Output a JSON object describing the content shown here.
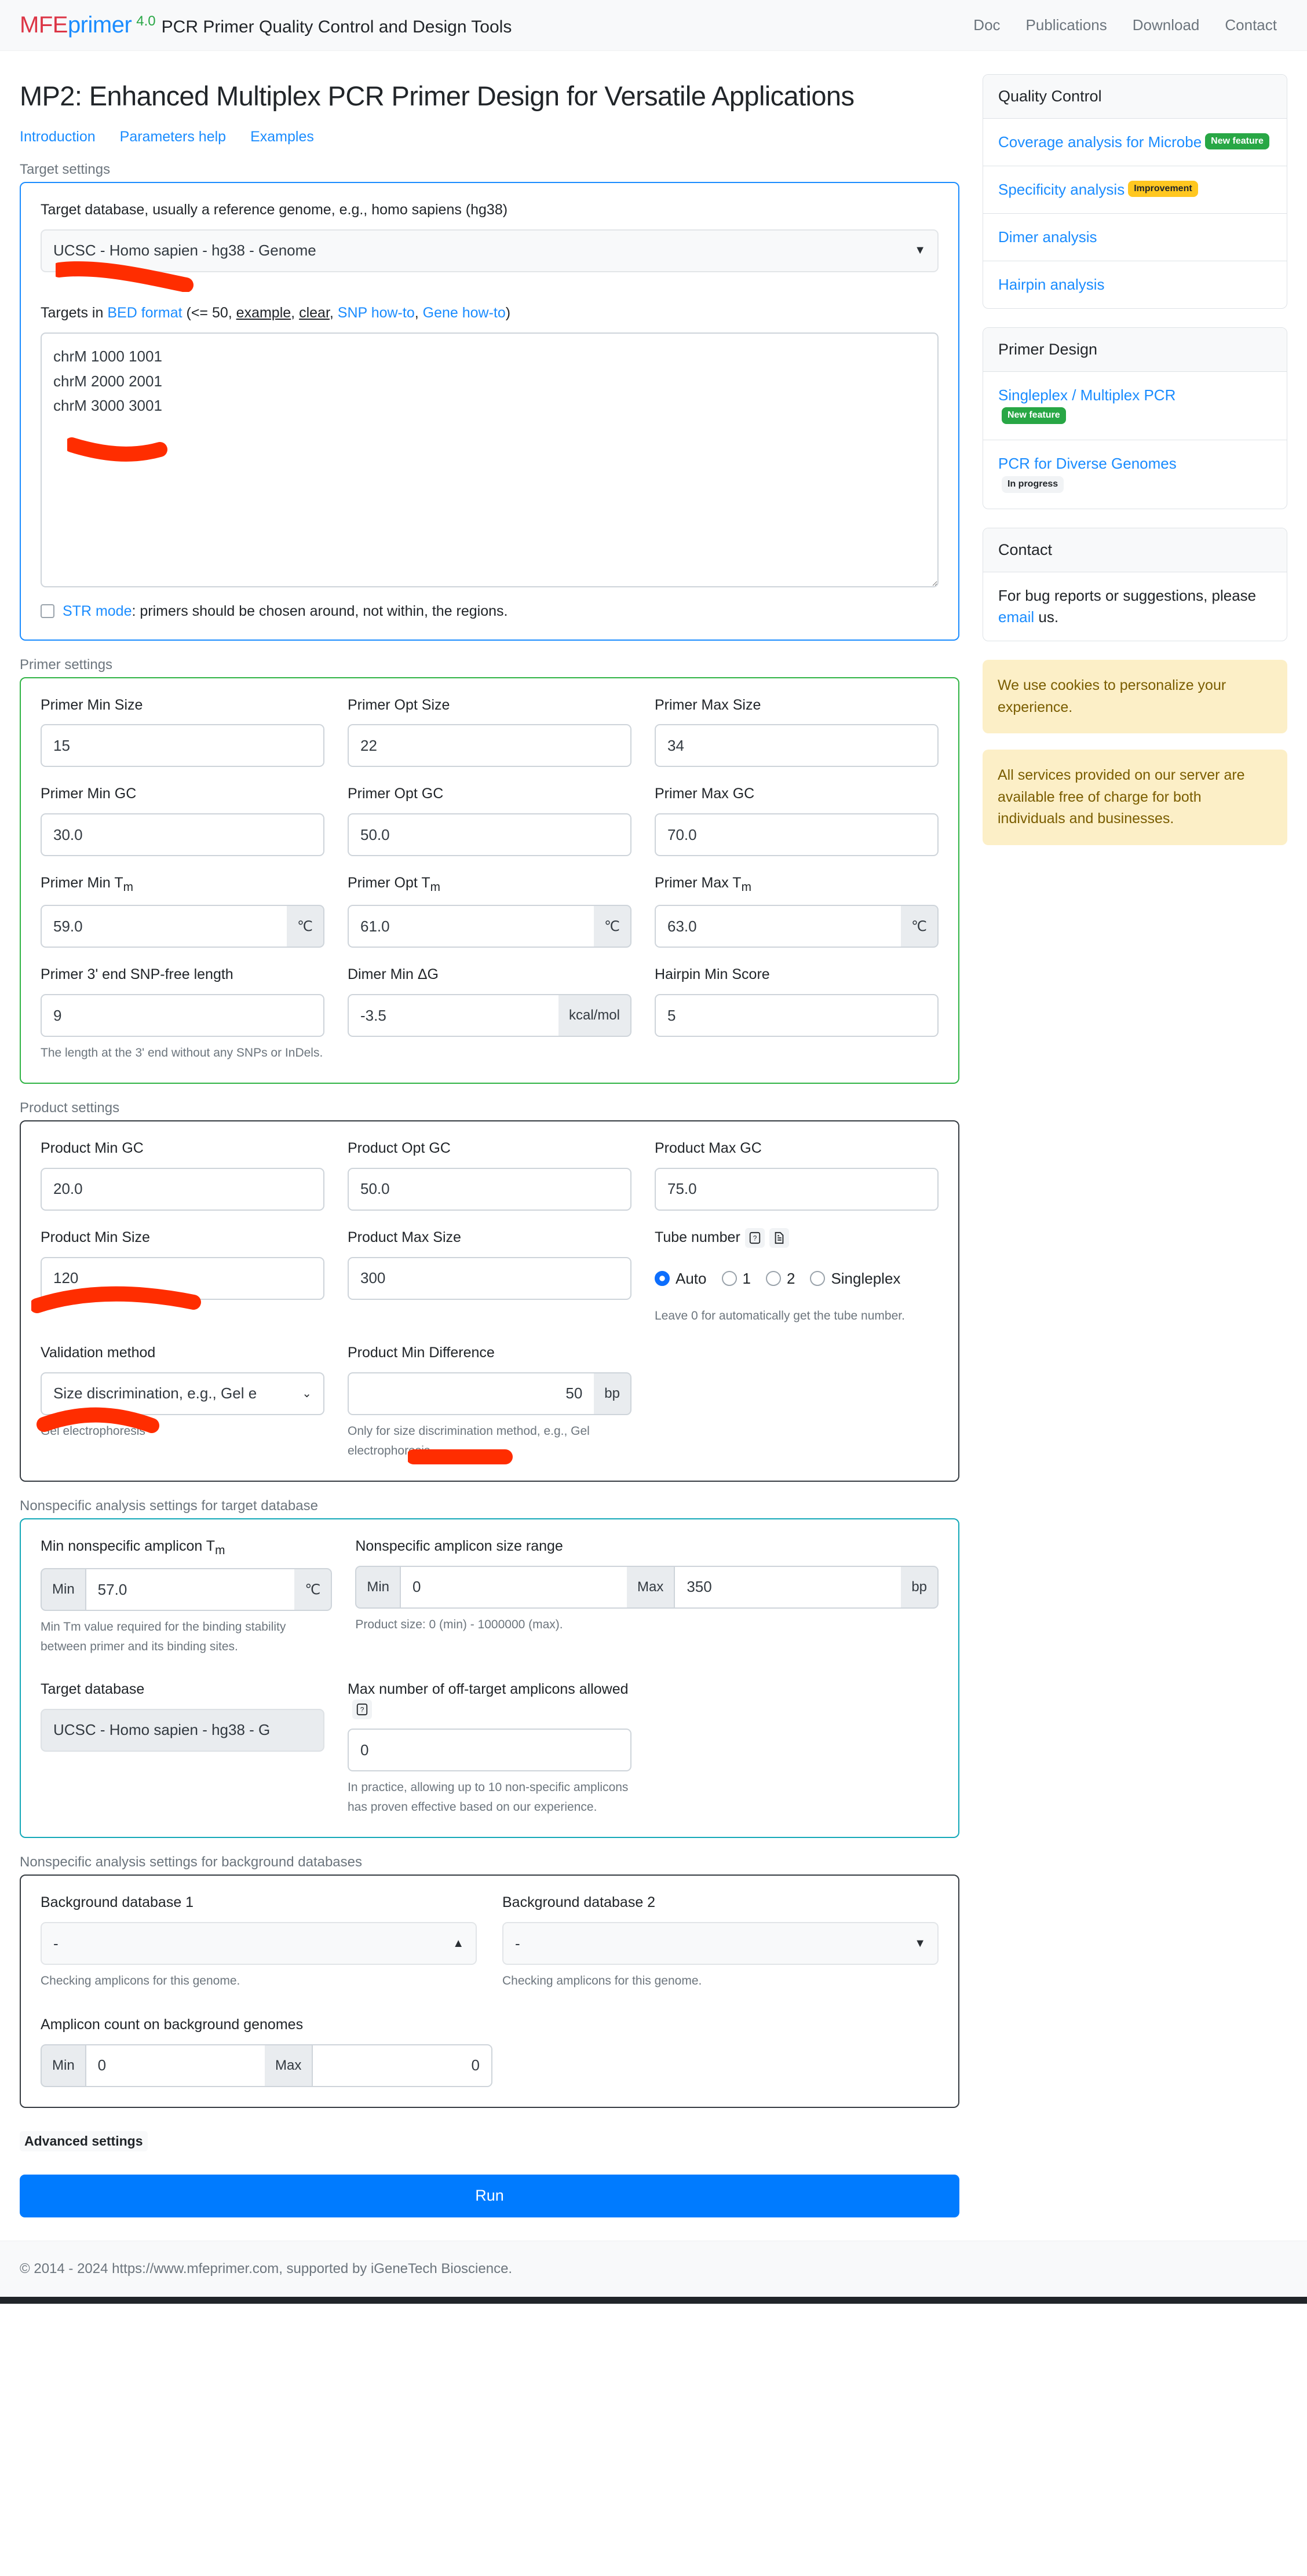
{
  "navbar": {
    "brand_mfe": "MFE",
    "brand_primer": "primer",
    "brand_version": "4.0",
    "brand_tagline": "PCR Primer Quality Control and Design Tools",
    "links": [
      "Doc",
      "Publications",
      "Download",
      "Contact"
    ]
  },
  "page": {
    "title": "MP2: Enhanced Multiplex PCR Primer Design for Versatile Applications",
    "sub_links": [
      "Introduction",
      "Parameters help",
      "Examples"
    ]
  },
  "target_settings": {
    "legend": "Target settings",
    "database_label": "Target database, usually a reference genome, e.g., homo sapiens (hg38)",
    "database_value": "UCSC - Homo sapien - hg38 - Genome",
    "targets_label_prefix": "Targets in ",
    "targets_bed_link": "BED format",
    "targets_paren_open": " (<= 50, ",
    "targets_example_link": "example",
    "targets_sep1": ", ",
    "targets_clear_link": "clear",
    "targets_sep2": ", ",
    "targets_snp_link": "SNP how-to",
    "targets_sep3": ", ",
    "targets_gene_link": "Gene how-to",
    "targets_paren_close": ")",
    "targets_value": "chrM 1000 1001\nchrM 2000 2001\nchrM 3000 3001",
    "str_mode_link": "STR mode",
    "str_mode_text": ": primers should be chosen around, not within, the regions."
  },
  "primer_settings": {
    "legend": "Primer settings",
    "min_size_label": "Primer Min Size",
    "min_size_value": "15",
    "opt_size_label": "Primer Opt Size",
    "opt_size_value": "22",
    "max_size_label": "Primer Max Size",
    "max_size_value": "34",
    "min_gc_label": "Primer Min GC",
    "min_gc_value": "30.0",
    "opt_gc_label": "Primer Opt GC",
    "opt_gc_value": "50.0",
    "max_gc_label": "Primer Max GC",
    "max_gc_value": "70.0",
    "min_tm_label_main": "Primer Min T",
    "min_tm_label_sub": "m",
    "min_tm_value": "59.0",
    "opt_tm_label_main": "Primer Opt T",
    "opt_tm_label_sub": "m",
    "opt_tm_value": "61.0",
    "max_tm_label_main": "Primer Max T",
    "max_tm_label_sub": "m",
    "max_tm_value": "63.0",
    "tm_unit": "℃",
    "snp_free_label": "Primer 3' end SNP-free length",
    "snp_free_value": "9",
    "snp_free_hint": "The length at the 3' end without any SNPs or InDels.",
    "dimer_label": "Dimer Min ΔG",
    "dimer_value": "-3.5",
    "dimer_unit": "kcal/mol",
    "hairpin_label": "Hairpin Min Score",
    "hairpin_value": "5"
  },
  "product_settings": {
    "legend": "Product settings",
    "min_gc_label": "Product Min GC",
    "min_gc_value": "20.0",
    "opt_gc_label": "Product Opt GC",
    "opt_gc_value": "50.0",
    "max_gc_label": "Product Max GC",
    "max_gc_value": "75.0",
    "min_size_label": "Product Min Size",
    "min_size_value": "120",
    "max_size_label": "Product Max Size",
    "max_size_value": "300",
    "tube_label": "Tube number",
    "tube_help_icon": "question-mark-icon",
    "tube_doc_icon": "document-icon",
    "tube_options": [
      "Auto",
      "1",
      "2",
      "Singleplex"
    ],
    "tube_selected": "Auto",
    "tube_hint": "Leave 0 for automatically get the tube number.",
    "validation_label": "Validation method",
    "validation_value": "Size discrimination, e.g., Gel e",
    "validation_hint": "Gel electrophoresis",
    "min_diff_label": "Product Min Difference",
    "min_diff_value": "50",
    "min_diff_unit": "bp",
    "min_diff_hint": "Only for size discrimination method, e.g., Gel electrophoresis."
  },
  "nonspecific_target": {
    "legend": "Nonspecific analysis settings for target database",
    "min_tm_label_main": "Min nonspecific amplicon T",
    "min_tm_label_sub": "m",
    "min_tm_prefix": "Min",
    "min_tm_value": "57.0",
    "min_tm_unit": "℃",
    "min_tm_hint": "Min Tm value required for the binding stability between primer and its binding sites.",
    "size_range_label": "Nonspecific amplicon size range",
    "size_min_prefix": "Min",
    "size_min_value": "0",
    "size_max_prefix": "Max",
    "size_max_value": "350",
    "size_unit": "bp",
    "size_hint": "Product size: 0 (min) - 1000000 (max).",
    "target_db_label": "Target database",
    "target_db_value": "UCSC - Homo sapien - hg38 - G",
    "offtarget_label": "Max number of off-target amplicons allowed",
    "offtarget_help_icon": "question-mark-icon",
    "offtarget_value": "0",
    "offtarget_hint": "In practice, allowing up to 10 non-specific amplicons has proven effective based on our experience."
  },
  "nonspecific_background": {
    "legend": "Nonspecific analysis settings for background databases",
    "db1_label": "Background database 1",
    "db1_value": "-",
    "db1_caret": "▲",
    "db1_hint": "Checking amplicons for this genome.",
    "db2_label": "Background database 2",
    "db2_value": "-",
    "db2_caret": "▼",
    "db2_hint": "Checking amplicons for this genome.",
    "count_label": "Amplicon count on background genomes",
    "count_min_prefix": "Min",
    "count_min_value": "0",
    "count_max_prefix": "Max",
    "count_max_value": "0"
  },
  "bottom": {
    "advanced_label": "Advanced settings",
    "run_label": "Run"
  },
  "sidebar": {
    "quality_control": {
      "title": "Quality Control",
      "items": [
        {
          "label": "Coverage analysis for Microbe",
          "badge": "New feature",
          "badge_type": "green"
        },
        {
          "label": "Specificity analysis",
          "badge": "Improvement",
          "badge_type": "amber"
        },
        {
          "label": "Dimer analysis",
          "badge": "",
          "badge_type": ""
        },
        {
          "label": "Hairpin analysis",
          "badge": "",
          "badge_type": ""
        }
      ]
    },
    "primer_design": {
      "title": "Primer Design",
      "items": [
        {
          "label": "Singleplex / Multiplex PCR",
          "badge": "New feature",
          "badge_type": "green"
        },
        {
          "label": "PCR for Diverse Genomes",
          "badge": "In progress",
          "badge_type": "gray"
        }
      ]
    },
    "contact": {
      "title": "Contact",
      "text_before": "For bug reports or suggestions, please ",
      "email_link": "email",
      "text_after": " us."
    },
    "notices": [
      "We use cookies to personalize your experience.",
      "All services provided on our server are available free of charge for both individuals and businesses."
    ]
  },
  "footer": {
    "text": "© 2014 - 2024 https://www.mfeprimer.com, supported by iGeneTech Bioscience."
  },
  "colors": {
    "brand_red": "#dc3545",
    "brand_blue": "#1a8cff",
    "brand_green": "#28a745",
    "accent_button": "#007bff",
    "annotation_red": "#ff2d00",
    "badge_green": "#28a745",
    "badge_amber": "#ffc720",
    "notice_bg": "#fcefc7"
  }
}
